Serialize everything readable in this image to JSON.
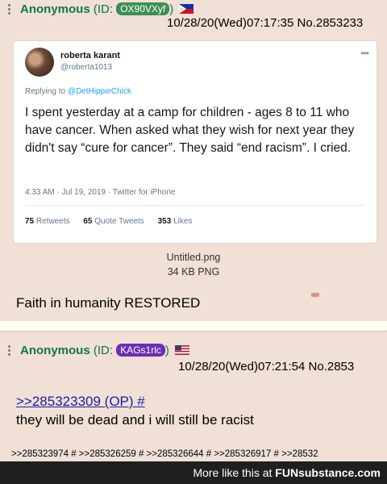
{
  "post1": {
    "name": "Anonymous",
    "id_prefix": "(ID:",
    "id_value": "OX90VXyf",
    "id_suffix": ")",
    "id_color": "#3c8f54",
    "flag": "philippines-flag",
    "datetime_no": "10/28/20(Wed)07:17:35 No.2853233",
    "tweet": {
      "author": "roberta karant",
      "handle": "@roberta1013",
      "replying_prefix": "Replying to",
      "replying_to": "@DetHippieChick",
      "text": "I spent yesterday at a camp for children - ages 8 to 11 who have cancer.  When asked what they wish for next year they didn't say “cure for cancer”. They said “end racism”. I cried.",
      "timestamp": "4:33 AM · Jul 19, 2019 · Twitter for iPhone",
      "retweets_count": "75",
      "retweets_label": "Retweets",
      "quotes_count": "65",
      "quotes_label": "Quote Tweets",
      "likes_count": "353",
      "likes_label": "Likes"
    },
    "file_name": "Untitled.png",
    "file_info": "34 KB PNG",
    "comment": "Faith in humanity RESTORED"
  },
  "post2": {
    "name": "Anonymous",
    "id_prefix": "(ID:",
    "id_value": "KAGs1rlc",
    "id_suffix": ")",
    "id_color": "#6a2fb5",
    "flag": "us-flag",
    "datetime_no": "10/28/20(Wed)07:21:54 No.2853",
    "quote_link": ">>285323309 (OP) #",
    "comment": "they will be dead and i will still be racist",
    "backlinks": ">>285323974 # >>285326259 # >>285326644 # >>285326917 # >>28532"
  },
  "footer": {
    "text": "More like this at",
    "brand": "FUNsubstance.com"
  }
}
